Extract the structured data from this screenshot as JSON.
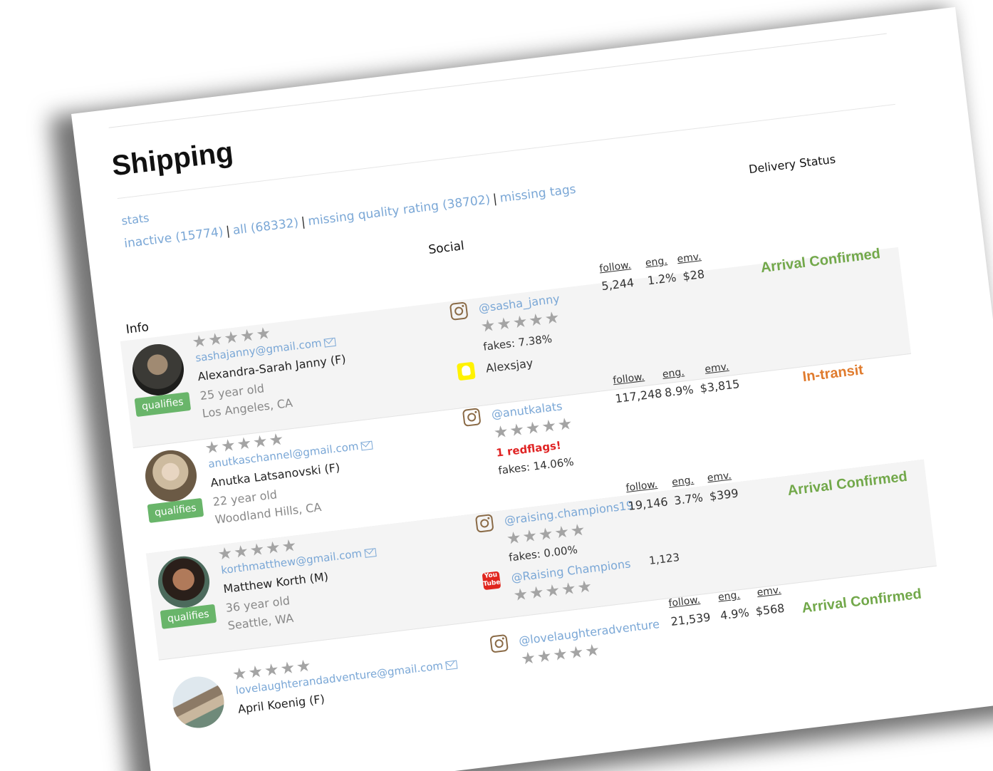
{
  "page": {
    "title": "Shipping"
  },
  "nav": {
    "stats": "stats",
    "filters": [
      {
        "label": "inactive (15774)"
      },
      {
        "label": "all (68332)"
      },
      {
        "label": "missing quality rating (38702)"
      },
      {
        "label": "missing tags"
      }
    ],
    "separator": "|"
  },
  "columns": {
    "info": "Info",
    "social": "Social",
    "delivery": "Delivery Status"
  },
  "metric_labels": {
    "follow": "follow.",
    "eng": "eng.",
    "emv": "emv."
  },
  "stars": "★★★★★",
  "colors": {
    "link": "#7aa7d6",
    "badge": "#69b56a",
    "confirmed": "#72a84a",
    "transit": "#e07b2d",
    "redflag": "#e02424"
  },
  "rows": [
    {
      "email": "sashajanny@gmail.com",
      "name": "Alexandra-Sarah Janny (F)",
      "age": "25 year old",
      "location": "Los Angeles, CA",
      "badge": "qualifies",
      "instagram": "@sasha_janny",
      "fakes": "fakes: 7.38%",
      "snapchat": "Alexsjay",
      "follow": "5,244",
      "eng": "1.2%",
      "emv": "$28",
      "status": "Arrival Confirmed"
    },
    {
      "email": "anutkaschannel@gmail.com",
      "name": "Anutka Latsanovski (F)",
      "age": "22 year old",
      "location": "Woodland Hills, CA",
      "badge": "qualifies",
      "instagram": "@anutkalats",
      "redflags": "1 redflags!",
      "fakes": "fakes: 14.06%",
      "follow": "117,248",
      "eng": "8.9%",
      "emv": "$3,815",
      "status": "In-transit"
    },
    {
      "email": "korthmatthew@gmail.com",
      "name": "Matthew Korth (M)",
      "age": "36 year old",
      "location": "Seattle, WA",
      "badge": "qualifies",
      "instagram": "@raising.champions19",
      "fakes": "fakes: 0.00%",
      "youtube": "@Raising Champions",
      "youtube_count": "1,123",
      "follow": "19,146",
      "eng": "3.7%",
      "emv": "$399",
      "status": "Arrival Confirmed"
    },
    {
      "email": "lovelaughterandadventure@gmail.com",
      "name": "April Koenig (F)",
      "instagram": "@lovelaughteradventure",
      "follow": "21,539",
      "eng": "4.9%",
      "emv": "$568",
      "status": "Arrival Confirmed"
    }
  ]
}
